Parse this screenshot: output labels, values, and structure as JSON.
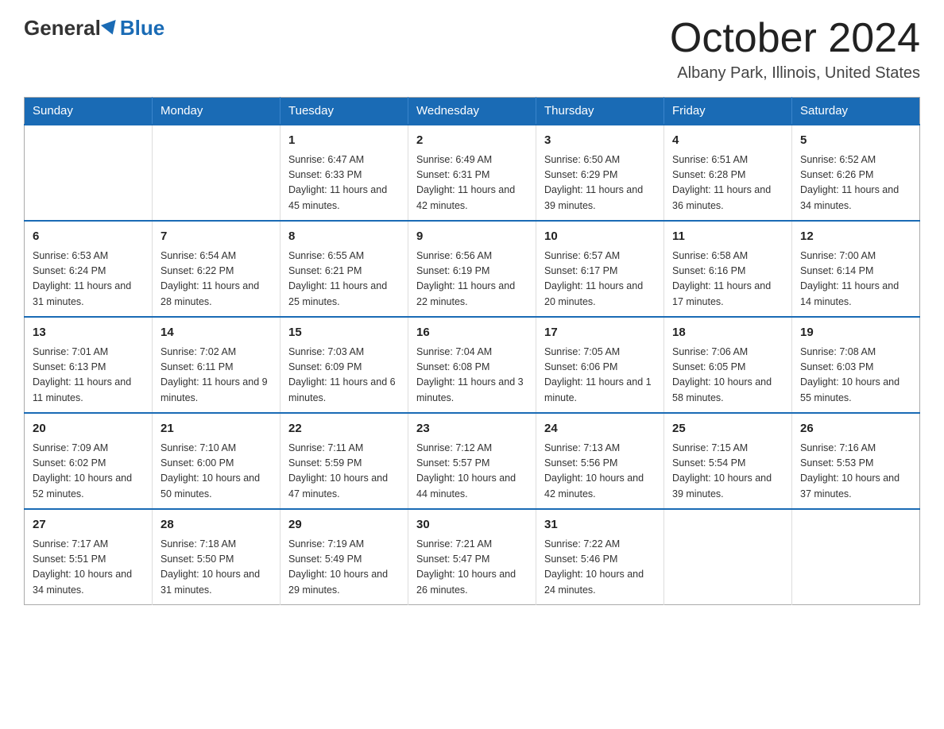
{
  "logo": {
    "general": "General",
    "blue": "Blue"
  },
  "title": "October 2024",
  "location": "Albany Park, Illinois, United States",
  "days_header": [
    "Sunday",
    "Monday",
    "Tuesday",
    "Wednesday",
    "Thursday",
    "Friday",
    "Saturday"
  ],
  "weeks": [
    [
      {
        "day": "",
        "sunrise": "",
        "sunset": "",
        "daylight": ""
      },
      {
        "day": "",
        "sunrise": "",
        "sunset": "",
        "daylight": ""
      },
      {
        "day": "1",
        "sunrise": "Sunrise: 6:47 AM",
        "sunset": "Sunset: 6:33 PM",
        "daylight": "Daylight: 11 hours and 45 minutes."
      },
      {
        "day": "2",
        "sunrise": "Sunrise: 6:49 AM",
        "sunset": "Sunset: 6:31 PM",
        "daylight": "Daylight: 11 hours and 42 minutes."
      },
      {
        "day": "3",
        "sunrise": "Sunrise: 6:50 AM",
        "sunset": "Sunset: 6:29 PM",
        "daylight": "Daylight: 11 hours and 39 minutes."
      },
      {
        "day": "4",
        "sunrise": "Sunrise: 6:51 AM",
        "sunset": "Sunset: 6:28 PM",
        "daylight": "Daylight: 11 hours and 36 minutes."
      },
      {
        "day": "5",
        "sunrise": "Sunrise: 6:52 AM",
        "sunset": "Sunset: 6:26 PM",
        "daylight": "Daylight: 11 hours and 34 minutes."
      }
    ],
    [
      {
        "day": "6",
        "sunrise": "Sunrise: 6:53 AM",
        "sunset": "Sunset: 6:24 PM",
        "daylight": "Daylight: 11 hours and 31 minutes."
      },
      {
        "day": "7",
        "sunrise": "Sunrise: 6:54 AM",
        "sunset": "Sunset: 6:22 PM",
        "daylight": "Daylight: 11 hours and 28 minutes."
      },
      {
        "day": "8",
        "sunrise": "Sunrise: 6:55 AM",
        "sunset": "Sunset: 6:21 PM",
        "daylight": "Daylight: 11 hours and 25 minutes."
      },
      {
        "day": "9",
        "sunrise": "Sunrise: 6:56 AM",
        "sunset": "Sunset: 6:19 PM",
        "daylight": "Daylight: 11 hours and 22 minutes."
      },
      {
        "day": "10",
        "sunrise": "Sunrise: 6:57 AM",
        "sunset": "Sunset: 6:17 PM",
        "daylight": "Daylight: 11 hours and 20 minutes."
      },
      {
        "day": "11",
        "sunrise": "Sunrise: 6:58 AM",
        "sunset": "Sunset: 6:16 PM",
        "daylight": "Daylight: 11 hours and 17 minutes."
      },
      {
        "day": "12",
        "sunrise": "Sunrise: 7:00 AM",
        "sunset": "Sunset: 6:14 PM",
        "daylight": "Daylight: 11 hours and 14 minutes."
      }
    ],
    [
      {
        "day": "13",
        "sunrise": "Sunrise: 7:01 AM",
        "sunset": "Sunset: 6:13 PM",
        "daylight": "Daylight: 11 hours and 11 minutes."
      },
      {
        "day": "14",
        "sunrise": "Sunrise: 7:02 AM",
        "sunset": "Sunset: 6:11 PM",
        "daylight": "Daylight: 11 hours and 9 minutes."
      },
      {
        "day": "15",
        "sunrise": "Sunrise: 7:03 AM",
        "sunset": "Sunset: 6:09 PM",
        "daylight": "Daylight: 11 hours and 6 minutes."
      },
      {
        "day": "16",
        "sunrise": "Sunrise: 7:04 AM",
        "sunset": "Sunset: 6:08 PM",
        "daylight": "Daylight: 11 hours and 3 minutes."
      },
      {
        "day": "17",
        "sunrise": "Sunrise: 7:05 AM",
        "sunset": "Sunset: 6:06 PM",
        "daylight": "Daylight: 11 hours and 1 minute."
      },
      {
        "day": "18",
        "sunrise": "Sunrise: 7:06 AM",
        "sunset": "Sunset: 6:05 PM",
        "daylight": "Daylight: 10 hours and 58 minutes."
      },
      {
        "day": "19",
        "sunrise": "Sunrise: 7:08 AM",
        "sunset": "Sunset: 6:03 PM",
        "daylight": "Daylight: 10 hours and 55 minutes."
      }
    ],
    [
      {
        "day": "20",
        "sunrise": "Sunrise: 7:09 AM",
        "sunset": "Sunset: 6:02 PM",
        "daylight": "Daylight: 10 hours and 52 minutes."
      },
      {
        "day": "21",
        "sunrise": "Sunrise: 7:10 AM",
        "sunset": "Sunset: 6:00 PM",
        "daylight": "Daylight: 10 hours and 50 minutes."
      },
      {
        "day": "22",
        "sunrise": "Sunrise: 7:11 AM",
        "sunset": "Sunset: 5:59 PM",
        "daylight": "Daylight: 10 hours and 47 minutes."
      },
      {
        "day": "23",
        "sunrise": "Sunrise: 7:12 AM",
        "sunset": "Sunset: 5:57 PM",
        "daylight": "Daylight: 10 hours and 44 minutes."
      },
      {
        "day": "24",
        "sunrise": "Sunrise: 7:13 AM",
        "sunset": "Sunset: 5:56 PM",
        "daylight": "Daylight: 10 hours and 42 minutes."
      },
      {
        "day": "25",
        "sunrise": "Sunrise: 7:15 AM",
        "sunset": "Sunset: 5:54 PM",
        "daylight": "Daylight: 10 hours and 39 minutes."
      },
      {
        "day": "26",
        "sunrise": "Sunrise: 7:16 AM",
        "sunset": "Sunset: 5:53 PM",
        "daylight": "Daylight: 10 hours and 37 minutes."
      }
    ],
    [
      {
        "day": "27",
        "sunrise": "Sunrise: 7:17 AM",
        "sunset": "Sunset: 5:51 PM",
        "daylight": "Daylight: 10 hours and 34 minutes."
      },
      {
        "day": "28",
        "sunrise": "Sunrise: 7:18 AM",
        "sunset": "Sunset: 5:50 PM",
        "daylight": "Daylight: 10 hours and 31 minutes."
      },
      {
        "day": "29",
        "sunrise": "Sunrise: 7:19 AM",
        "sunset": "Sunset: 5:49 PM",
        "daylight": "Daylight: 10 hours and 29 minutes."
      },
      {
        "day": "30",
        "sunrise": "Sunrise: 7:21 AM",
        "sunset": "Sunset: 5:47 PM",
        "daylight": "Daylight: 10 hours and 26 minutes."
      },
      {
        "day": "31",
        "sunrise": "Sunrise: 7:22 AM",
        "sunset": "Sunset: 5:46 PM",
        "daylight": "Daylight: 10 hours and 24 minutes."
      },
      {
        "day": "",
        "sunrise": "",
        "sunset": "",
        "daylight": ""
      },
      {
        "day": "",
        "sunrise": "",
        "sunset": "",
        "daylight": ""
      }
    ]
  ]
}
